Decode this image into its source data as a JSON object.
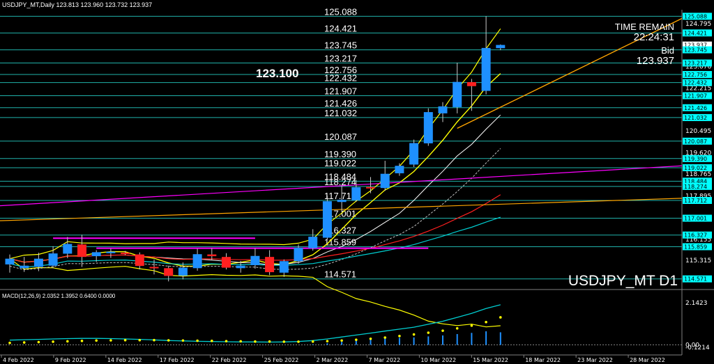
{
  "header": {
    "symbol_line": "USDJPY_MT,Daily  123.813 123.960 123.732 123.937",
    "time_remain_label": "TIME REMAIN",
    "time_remain_value": "22:24:31",
    "bid_label": "Bid",
    "bid_value": "123.937",
    "watermark": "USDJPY_MT D1",
    "highlight_price": "123.100",
    "macd_label": "MACD(12,26,9) 2.0352 1.3952 0.6400 0.0000"
  },
  "colors": {
    "background": "#000000",
    "level_line": "#20b2aa",
    "bull_candle": "#1e90ff",
    "bear_candle": "#ff2020",
    "bb_band": "#ffff00",
    "ma_red": "#ff2020",
    "ma_cyan": "#00ced1",
    "trend_magenta": "#ff00ff",
    "trend_orange": "#ffa500",
    "tag_bg": "#00ffff",
    "macd_signal": "#ffff00",
    "macd_hist": "#1e90ff"
  },
  "chart_data": {
    "type": "candlestick",
    "title": "USDJPY_MT,Daily",
    "ylim": [
      114.2,
      125.35
    ],
    "x_ticks": [
      "4 Feb 2022",
      "9 Feb 2022",
      "14 Feb 2022",
      "17 Feb 2022",
      "22 Feb 2022",
      "25 Feb 2022",
      "2 Mar 2022",
      "7 Mar 2022",
      "10 Mar 2022",
      "15 Mar 2022",
      "18 Mar 2022",
      "23 Mar 2022",
      "28 Mar 2022"
    ],
    "y_axis_ticks": [
      "124.795",
      "124.421",
      "123.937",
      "123.745",
      "123.076",
      "122.215",
      "121.907",
      "121.426",
      "121.032",
      "120.495",
      "120.087",
      "119.620",
      "119.390",
      "119.022",
      "118.765",
      "118.484",
      "118.274",
      "117.895",
      "117.712",
      "117.025",
      "116.327",
      "116.155",
      "115.859",
      "115.315",
      "114.571"
    ],
    "level_lines": [
      "125.088",
      "124.421",
      "123.745",
      "123.217",
      "122.756",
      "122.432",
      "121.907",
      "121.426",
      "121.032",
      "120.087",
      "119.390",
      "119.022",
      "118.484",
      "118.274",
      "117.712",
      "117.001",
      "116.327",
      "115.859",
      "114.571"
    ],
    "level_line_labels": [
      "125.088",
      "124.421",
      "123.745",
      "123.217",
      "122.756",
      "122.432",
      "121.907",
      "121.426",
      "121.032",
      "120.087",
      "119.390",
      "119.022",
      "118.484",
      "118.274",
      "117.712",
      "117.001",
      "116.327",
      "115.859",
      "114.571"
    ],
    "right_tags": [
      "125.088",
      "124.421",
      "123.937",
      "123.745",
      "123.217",
      "122.756",
      "122.432",
      "121.907",
      "121.426",
      "121.032",
      "120.087",
      "119.390",
      "119.022",
      "118.484",
      "118.274",
      "117.712",
      "117.001",
      "116.327",
      "115.859",
      "114.571"
    ],
    "candles": [
      {
        "o": 115.15,
        "h": 115.55,
        "l": 114.82,
        "c": 115.38
      },
      {
        "o": 115.0,
        "h": 115.45,
        "l": 114.85,
        "c": 115.1
      },
      {
        "o": 115.05,
        "h": 115.62,
        "l": 114.88,
        "c": 115.38
      },
      {
        "o": 115.1,
        "h": 115.88,
        "l": 115.0,
        "c": 115.59
      },
      {
        "o": 115.58,
        "h": 116.25,
        "l": 115.4,
        "c": 115.97
      },
      {
        "o": 115.95,
        "h": 116.34,
        "l": 115.05,
        "c": 115.45
      },
      {
        "o": 115.48,
        "h": 115.72,
        "l": 115.25,
        "c": 115.64
      },
      {
        "o": 115.6,
        "h": 115.78,
        "l": 115.41,
        "c": 115.66
      },
      {
        "o": 115.62,
        "h": 115.69,
        "l": 115.52,
        "c": 115.57
      },
      {
        "o": 115.55,
        "h": 115.63,
        "l": 114.95,
        "c": 115.09
      },
      {
        "o": 115.05,
        "h": 115.35,
        "l": 114.75,
        "c": 115.04
      },
      {
        "o": 115.0,
        "h": 115.1,
        "l": 114.47,
        "c": 114.69
      },
      {
        "o": 114.7,
        "h": 115.23,
        "l": 114.55,
        "c": 115.02
      },
      {
        "o": 115.0,
        "h": 115.78,
        "l": 114.9,
        "c": 115.56
      },
      {
        "o": 115.55,
        "h": 115.8,
        "l": 115.32,
        "c": 115.48
      },
      {
        "o": 115.45,
        "h": 115.6,
        "l": 114.95,
        "c": 115.02
      },
      {
        "o": 115.0,
        "h": 115.29,
        "l": 114.82,
        "c": 115.1
      },
      {
        "o": 115.12,
        "h": 115.8,
        "l": 114.98,
        "c": 115.49
      },
      {
        "o": 115.45,
        "h": 115.72,
        "l": 114.72,
        "c": 114.84
      },
      {
        "o": 114.82,
        "h": 115.35,
        "l": 114.65,
        "c": 115.28
      },
      {
        "o": 115.28,
        "h": 115.95,
        "l": 115.18,
        "c": 115.82
      },
      {
        "o": 115.8,
        "h": 116.56,
        "l": 115.7,
        "c": 116.26
      },
      {
        "o": 116.22,
        "h": 117.9,
        "l": 116.15,
        "c": 117.68
      },
      {
        "o": 117.65,
        "h": 118.32,
        "l": 117.25,
        "c": 117.74
      },
      {
        "o": 117.72,
        "h": 118.54,
        "l": 117.66,
        "c": 118.24
      },
      {
        "o": 118.25,
        "h": 118.65,
        "l": 118.0,
        "c": 118.23
      },
      {
        "o": 118.21,
        "h": 119.3,
        "l": 118.1,
        "c": 118.78
      },
      {
        "o": 118.8,
        "h": 119.2,
        "l": 118.7,
        "c": 119.1
      },
      {
        "o": 119.15,
        "h": 120.15,
        "l": 119.05,
        "c": 120.01
      },
      {
        "o": 120.0,
        "h": 121.4,
        "l": 119.9,
        "c": 121.25
      },
      {
        "o": 121.2,
        "h": 121.65,
        "l": 120.85,
        "c": 121.48
      },
      {
        "o": 121.45,
        "h": 123.23,
        "l": 121.2,
        "c": 122.46
      },
      {
        "o": 122.45,
        "h": 122.58,
        "l": 121.3,
        "c": 122.29
      },
      {
        "o": 122.1,
        "h": 125.09,
        "l": 121.96,
        "c": 123.82
      },
      {
        "o": 123.81,
        "h": 123.96,
        "l": 123.73,
        "c": 123.94
      }
    ],
    "macd": {
      "label": "MACD(12,26,9)",
      "values": [
        "2.0352",
        "1.3952",
        "0.6400",
        "0.0000"
      ],
      "y_ticks": [
        "2.1423",
        "0.00",
        "-0.1214"
      ],
      "ylim": [
        -0.16,
        2.25
      ],
      "main": [
        0.24,
        0.26,
        0.28,
        0.3,
        0.32,
        0.33,
        0.33,
        0.32,
        0.3,
        0.28,
        0.25,
        0.22,
        0.2,
        0.18,
        0.17,
        0.16,
        0.15,
        0.15,
        0.14,
        0.15,
        0.17,
        0.22,
        0.3,
        0.4,
        0.5,
        0.6,
        0.7,
        0.8,
        0.9,
        1.05,
        1.2,
        1.4,
        1.6,
        1.85,
        2.04
      ],
      "signal": [
        0.1,
        0.12,
        0.14,
        0.16,
        0.18,
        0.2,
        0.22,
        0.23,
        0.24,
        0.24,
        0.24,
        0.23,
        0.22,
        0.21,
        0.2,
        0.19,
        0.18,
        0.17,
        0.17,
        0.16,
        0.16,
        0.17,
        0.19,
        0.22,
        0.26,
        0.31,
        0.37,
        0.45,
        0.53,
        0.62,
        0.72,
        0.84,
        0.98,
        1.16,
        1.4
      ],
      "hist": [
        0.0,
        0.0,
        0.0,
        0.0,
        0.0,
        0.0,
        0.0,
        0.0,
        0.0,
        0.0,
        0.0,
        0.0,
        0.0,
        0.0,
        0.0,
        0.0,
        0.0,
        0.0,
        0.0,
        0.0,
        0.0,
        0.03,
        0.08,
        0.15,
        0.22,
        0.28,
        0.32,
        0.36,
        0.38,
        0.43,
        0.48,
        0.55,
        0.61,
        0.69,
        0.64
      ]
    }
  }
}
